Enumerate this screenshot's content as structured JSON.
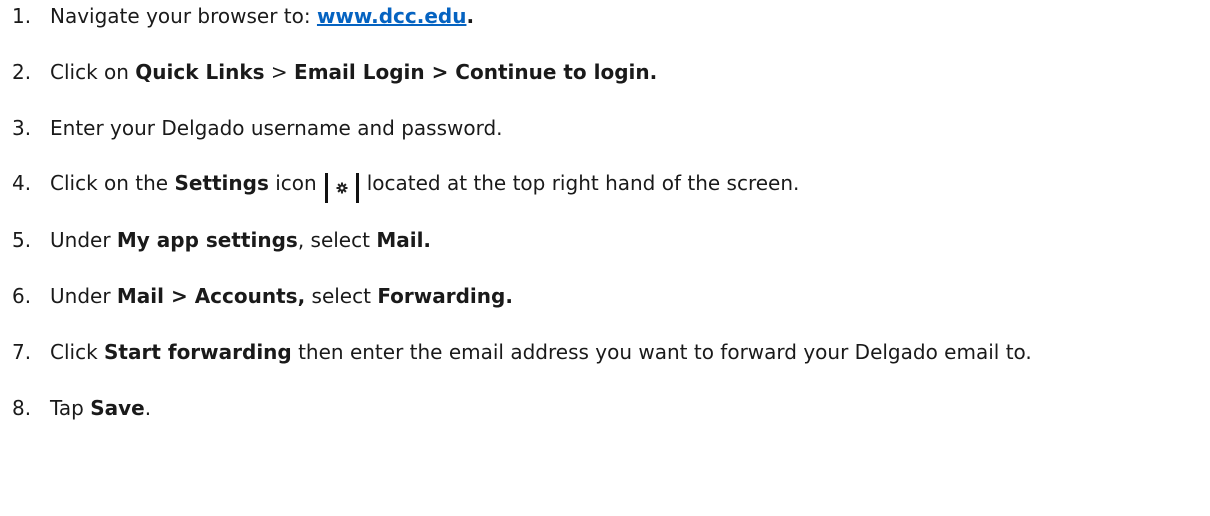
{
  "steps": [
    {
      "number": "1.",
      "text": "Navigate your browser to: ",
      "link": "www.dcc.edu",
      "end": "."
    },
    {
      "number": "2.",
      "pre": "Click on ",
      "b1": "Quick Links",
      "mid": " > ",
      "b2": "Email Login > Continue to login."
    },
    {
      "number": "3.",
      "text": "Enter your Delgado username and password."
    },
    {
      "number": "4.",
      "pre": "Click on the ",
      "b1": "Settings",
      "mid": " icon",
      "post": "located at the top right hand of the screen.",
      "icon": "gear-icon"
    },
    {
      "number": "5.",
      "pre": "Under ",
      "b1": "My app settings",
      "mid": ", select ",
      "b2": "Mail."
    },
    {
      "number": "6.",
      "pre": "Under ",
      "b1": "Mail > Accounts,",
      "mid": " select ",
      "b2": "Forwarding."
    },
    {
      "number": "7.",
      "pre": "Click ",
      "b1": "Start forwarding",
      "post": " then enter the email address you want to forward your Delgado email to."
    },
    {
      "number": "8.",
      "pre": "Tap ",
      "b1": "Save",
      "post": "."
    }
  ]
}
